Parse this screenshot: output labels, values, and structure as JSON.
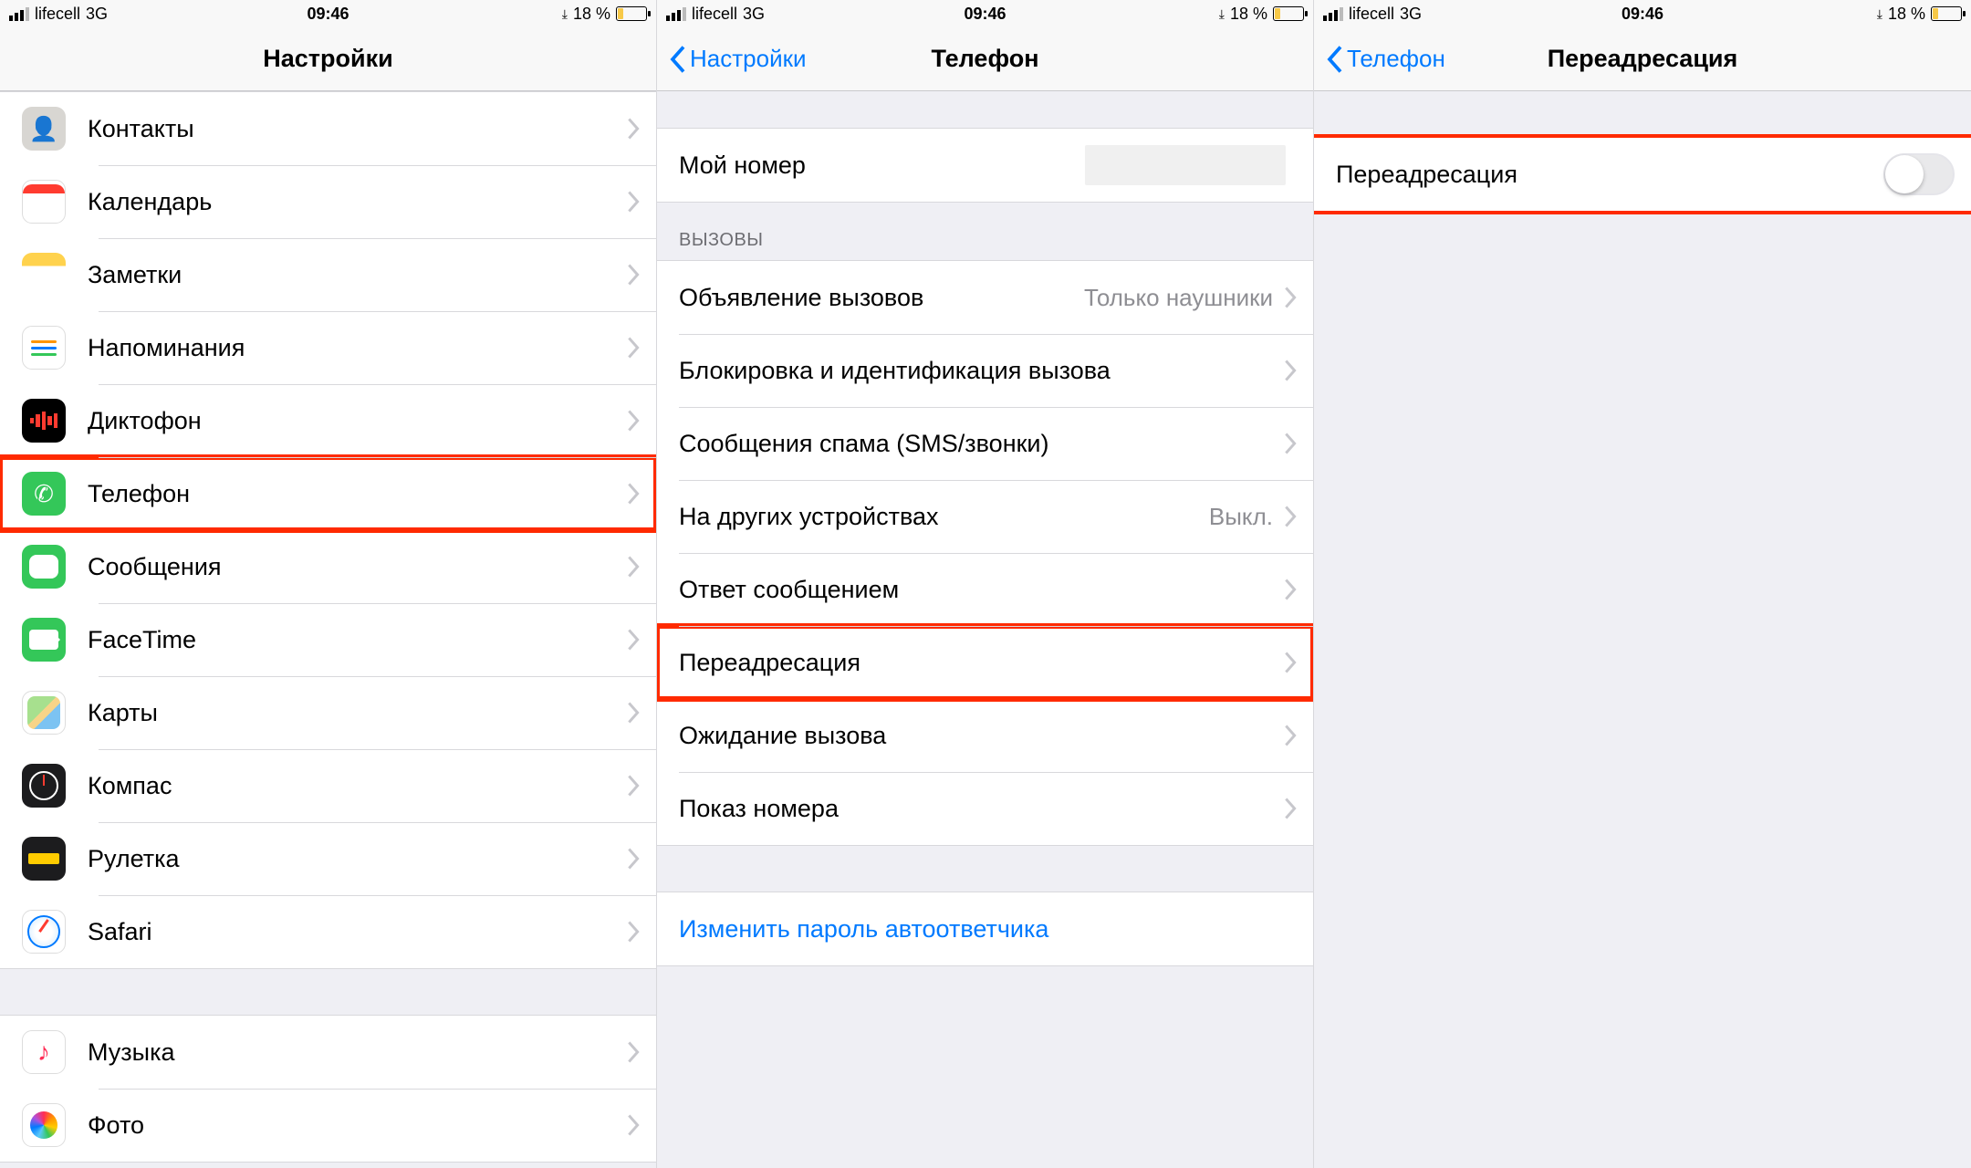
{
  "status": {
    "carrier": "lifecell",
    "network": "3G",
    "time": "09:46",
    "battery_text": "18 %"
  },
  "col1": {
    "title": "Настройки",
    "items": [
      {
        "label": "Контакты",
        "icon": "contacts"
      },
      {
        "label": "Календарь",
        "icon": "calendar"
      },
      {
        "label": "Заметки",
        "icon": "notes"
      },
      {
        "label": "Напоминания",
        "icon": "reminders"
      },
      {
        "label": "Диктофон",
        "icon": "voice"
      },
      {
        "label": "Телефон",
        "icon": "phone",
        "highlight": true
      },
      {
        "label": "Сообщения",
        "icon": "msg"
      },
      {
        "label": "FaceTime",
        "icon": "facetime"
      },
      {
        "label": "Карты",
        "icon": "maps"
      },
      {
        "label": "Компас",
        "icon": "compass"
      },
      {
        "label": "Рулетка",
        "icon": "measure"
      },
      {
        "label": "Safari",
        "icon": "safari"
      }
    ],
    "group2": [
      {
        "label": "Музыка",
        "icon": "music"
      },
      {
        "label": "Фото",
        "icon": "photos"
      }
    ]
  },
  "col2": {
    "back": "Настройки",
    "title": "Телефон",
    "my_number_label": "Мой номер",
    "section_calls": "ВЫЗОВЫ",
    "calls": [
      {
        "label": "Объявление вызовов",
        "value": "Только наушники"
      },
      {
        "label": "Блокировка и идентификация вызова",
        "value": ""
      },
      {
        "label": "Сообщения спама (SMS/звонки)",
        "value": ""
      },
      {
        "label": "На других устройствах",
        "value": "Выкл."
      },
      {
        "label": "Ответ сообщением",
        "value": ""
      },
      {
        "label": "Переадресация",
        "value": "",
        "highlight": true
      },
      {
        "label": "Ожидание вызова",
        "value": ""
      },
      {
        "label": "Показ номера",
        "value": ""
      }
    ],
    "change_pw": "Изменить пароль автоответчика"
  },
  "col3": {
    "back": "Телефон",
    "title": "Переадресация",
    "toggle_label": "Переадресация",
    "toggle_on": false
  }
}
